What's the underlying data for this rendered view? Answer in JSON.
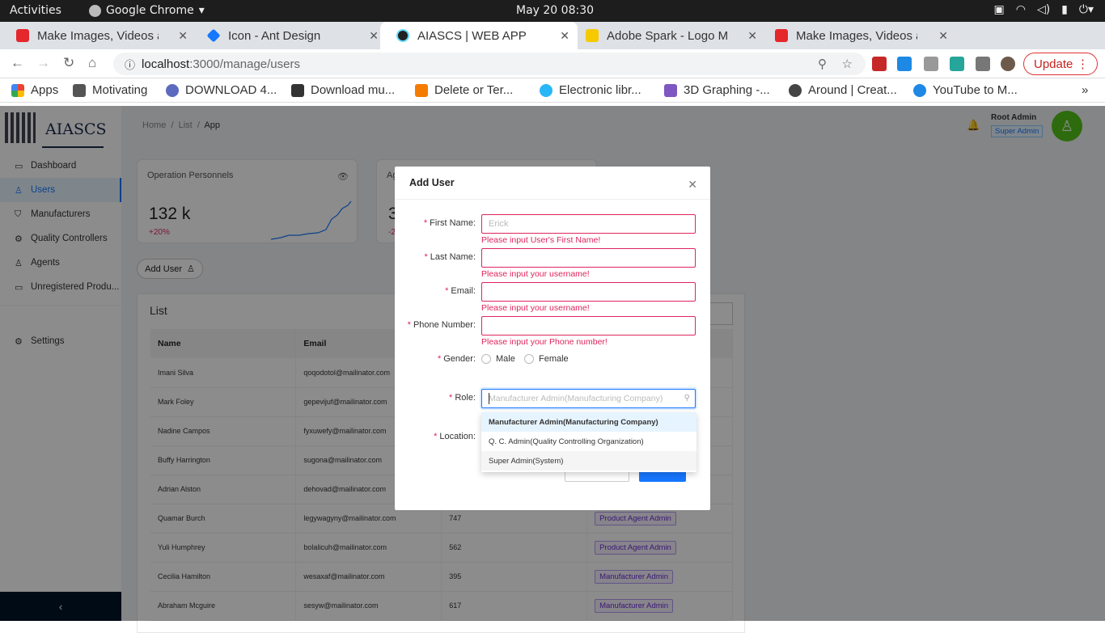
{
  "os_bar": {
    "activities": "Activities",
    "app_name": "Google Chrome",
    "clock": "May 20  08:30"
  },
  "tabs": [
    {
      "title": "Make Images, Videos and",
      "favicon_color": "#e5262b"
    },
    {
      "title": "Icon - Ant Design",
      "favicon_color": "#1677ff"
    },
    {
      "title": "AIASCS | WEB APP",
      "favicon_color": "#61dafb"
    },
    {
      "title": "Adobe Spark - Logo Make",
      "favicon_color": "#f6c900"
    },
    {
      "title": "Make Images, Videos and",
      "favicon_color": "#e5262b"
    }
  ],
  "address": {
    "host": "localhost",
    "path": ":3000/manage/users"
  },
  "update_label": "Update",
  "bookmarks": [
    "Apps",
    "Motivating",
    "DOWNLOAD 4...",
    "Download mu...",
    "Delete or Ter...",
    "Electronic libr...",
    "3D Graphing -...",
    "Around | Creat...",
    "YouTube to M..."
  ],
  "logo_text": "AIASCS",
  "menu": [
    "Dashboard",
    "Users",
    "Manufacturers",
    "Quality Controllers",
    "Agents",
    "Unregistered Produ...",
    "Settings"
  ],
  "breadcrumb": {
    "home": "Home",
    "list": "List",
    "current": "App"
  },
  "user": {
    "name": "Root Admin",
    "role": "Super Admin"
  },
  "cards": [
    {
      "title": "Operation Personnels",
      "value": "132 k",
      "delta": "+20%"
    },
    {
      "title": "Ag",
      "value": "3",
      "delta": "-2"
    }
  ],
  "add_user_button": "Add User",
  "list": {
    "title": "List",
    "columns": [
      "Name",
      "Email",
      "",
      ""
    ],
    "rows": [
      {
        "name": "Imani Silva",
        "email": "qoqodotol@mailinator.com",
        "num": "",
        "role": ""
      },
      {
        "name": "Mark Foley",
        "email": "gepevijuf@mailinator.com",
        "num": "",
        "role": ""
      },
      {
        "name": "Nadine Campos",
        "email": "fyxuwefy@mailinator.com",
        "num": "",
        "role": ""
      },
      {
        "name": "Buffy Harrington",
        "email": "sugona@mailinator.com",
        "num": "",
        "role": ""
      },
      {
        "name": "Adrian Alston",
        "email": "dehovad@mailinator.com",
        "num": "",
        "role": ""
      },
      {
        "name": "Quamar Burch",
        "email": "legywagyny@mailinator.com",
        "num": "747",
        "role": "Product Agent Admin"
      },
      {
        "name": "Yuli Humphrey",
        "email": "bolalicuh@mailinator.com",
        "num": "562",
        "role": "Product Agent Admin"
      },
      {
        "name": "Cecilia Hamilton",
        "email": "wesaxaf@mailinator.com",
        "num": "395",
        "role": "Manufacturer Admin"
      },
      {
        "name": "Abraham Mcguire",
        "email": "sesyw@mailinator.com",
        "num": "617",
        "role": "Manufacturer Admin"
      }
    ]
  },
  "modal": {
    "title": "Add User",
    "first_name": {
      "label": "First Name",
      "placeholder": "Erick",
      "error": "Please input User's First Name!"
    },
    "last_name": {
      "label": "Last Name",
      "error": "Please input your username!"
    },
    "email": {
      "label": "Email",
      "error": "Please input your username!"
    },
    "phone": {
      "label": "Phone Number",
      "error": "Please input your Phone number!"
    },
    "gender": {
      "label": "Gender",
      "options": [
        "Male",
        "Female"
      ]
    },
    "role": {
      "label": "Role",
      "placeholder": "Manufacturer Admin(Manufacturing Company)",
      "options": [
        "Manufacturer Admin(Manufacturing Company)",
        "Q. C. Admin(Quality Controlling Organization)",
        "Super Admin(System)"
      ]
    },
    "location": {
      "label": "Location"
    }
  }
}
